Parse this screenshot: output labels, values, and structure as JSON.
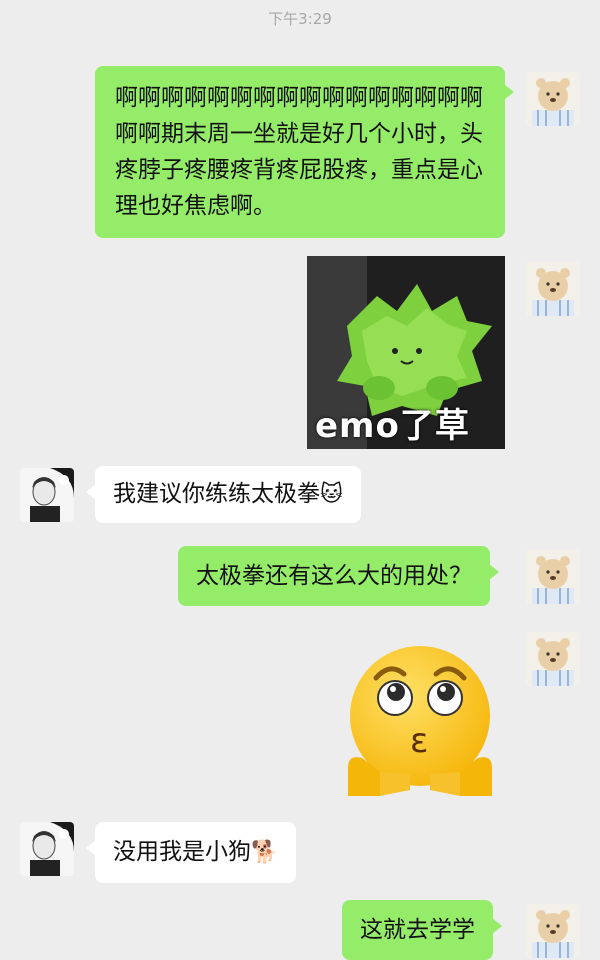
{
  "status": {
    "time": "下午3:29"
  },
  "messages": [
    {
      "side": "right",
      "type": "text",
      "text": "啊啊啊啊啊啊啊啊啊啊啊啊啊啊啊啊啊啊期末周一坐就是好几个小时，头疼脖子疼腰疼背疼屁股疼，重点是心理也好焦虑啊。"
    },
    {
      "side": "right",
      "type": "sticker",
      "caption": "emo了草"
    },
    {
      "side": "left",
      "type": "text",
      "text": "我建议你练练太极拳",
      "emoji": "🐱"
    },
    {
      "side": "right",
      "type": "text",
      "text": "太极拳还有这么大的用处？"
    },
    {
      "side": "right",
      "type": "sticker",
      "emoji": "🥺"
    },
    {
      "side": "left",
      "type": "text",
      "text": "没用我是小狗",
      "emoji": "🐕"
    },
    {
      "side": "right",
      "type": "text",
      "text": "这就去学学"
    }
  ],
  "colors": {
    "my_bubble": "#95ec69",
    "other_bubble": "#ffffff",
    "background": "#ededed"
  }
}
